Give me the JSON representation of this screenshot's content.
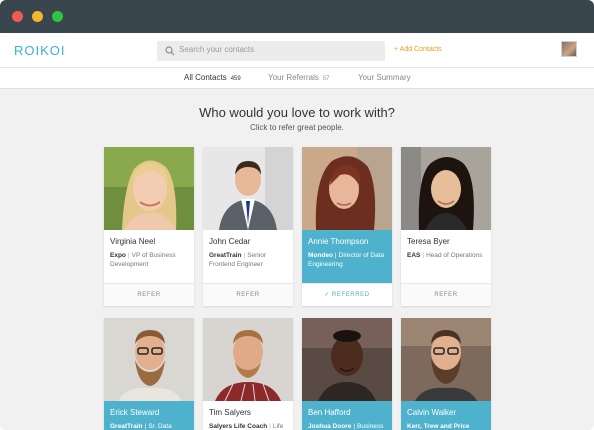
{
  "window": {
    "controls": [
      "close",
      "minimize",
      "zoom"
    ]
  },
  "header": {
    "logo": "ROIKOI",
    "search_placeholder": "Search your contacts",
    "add_contacts": "+ Add Contacts"
  },
  "tabs": [
    {
      "label": "All Contacts",
      "count": "459",
      "active": true
    },
    {
      "label": "Your Referrals",
      "count": "57",
      "active": false
    },
    {
      "label": "Your Summary",
      "count": "",
      "active": false
    }
  ],
  "hero": {
    "title": "Who would you love to work with?",
    "subtitle": "Click to refer great people."
  },
  "cards": [
    {
      "name": "Virginia Neel",
      "company": "Expo",
      "role": "VP of Business Development",
      "action": "REFER",
      "referred": false
    },
    {
      "name": "John Cedar",
      "company": "GreatTrain",
      "role": "Senior Frontend Engineer",
      "action": "REFER",
      "referred": false
    },
    {
      "name": "Annie Thompson",
      "company": "Mondeo",
      "role": "Director of Data Engineering",
      "action": "REFERRED",
      "referred": true
    },
    {
      "name": "Teresa Byer",
      "company": "EAS",
      "role": "Head of Operations",
      "action": "REFER",
      "referred": false
    },
    {
      "name": "Erick Steward",
      "company": "GreatTrain",
      "role": "Sr. Data",
      "action": "",
      "referred": true
    },
    {
      "name": "Tim Salyers",
      "company": "Salyers Life Coach",
      "role": "Life",
      "action": "",
      "referred": false
    },
    {
      "name": "Ben Hafford",
      "company": "Joshua Doore",
      "role": "Business",
      "action": "",
      "referred": true
    },
    {
      "name": "Calvin Walker",
      "company": "Kerr, Trew and Price",
      "role": "",
      "action": "",
      "referred": true
    }
  ],
  "colors": {
    "accent": "#4fb2cd",
    "add_link": "#ef9a1a",
    "titlebar": "#3a464d"
  }
}
